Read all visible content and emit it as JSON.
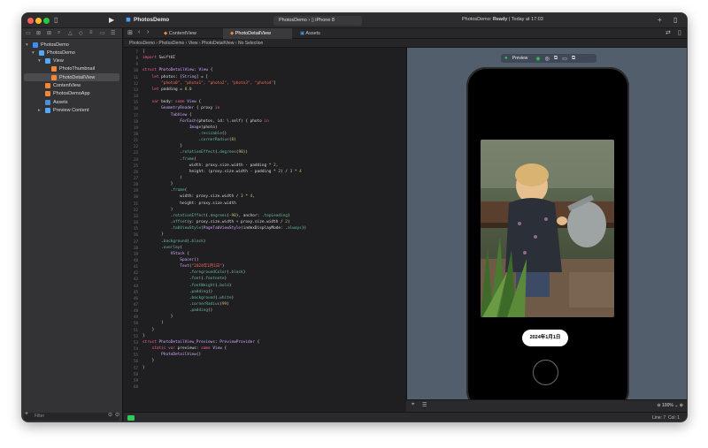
{
  "window": {
    "project": "PhotosDemo",
    "scheme": "PhotosDemo",
    "device": "iPhone 8",
    "status_prefix": "PhotosDemo: ",
    "status_state": "Ready",
    "status_time": " | Today at 17:03"
  },
  "sidebar": {
    "items": [
      {
        "label": "PhotosDemo",
        "indent": 0,
        "disclosure": "▾",
        "icon": "project-icon",
        "color": "#3b8ef3",
        "selected": false
      },
      {
        "label": "PhotosDemo",
        "indent": 1,
        "disclosure": "▾",
        "icon": "folder-icon",
        "color": "#56a8f5",
        "selected": false
      },
      {
        "label": "View",
        "indent": 2,
        "disclosure": "▾",
        "icon": "folder-icon",
        "color": "#56a8f5",
        "selected": false
      },
      {
        "label": "PhotoThumbnail",
        "indent": 3,
        "disclosure": "",
        "icon": "swift-file-icon",
        "color": "#f0873a",
        "selected": false
      },
      {
        "label": "PhotoDetailView",
        "indent": 3,
        "disclosure": "",
        "icon": "swift-file-icon",
        "color": "#f0873a",
        "selected": true
      },
      {
        "label": "ContentView",
        "indent": 2,
        "disclosure": "",
        "icon": "swift-file-icon",
        "color": "#f0873a",
        "selected": false
      },
      {
        "label": "PhotosDemoApp",
        "indent": 2,
        "disclosure": "",
        "icon": "swift-file-icon",
        "color": "#f0873a",
        "selected": false
      },
      {
        "label": "Assets",
        "indent": 2,
        "disclosure": "",
        "icon": "assets-icon",
        "color": "#4a90d9",
        "selected": false
      },
      {
        "label": "Preview Content",
        "indent": 2,
        "disclosure": "▸",
        "icon": "folder-icon",
        "color": "#56a8f5",
        "selected": false
      }
    ],
    "filter_placeholder": "Filter"
  },
  "tabs": [
    {
      "label": "ContentView",
      "active": false
    },
    {
      "label": "PhotoDetailView",
      "active": true
    },
    {
      "label": "Assets",
      "active": false
    }
  ],
  "jumpbar": {
    "crumbs": [
      "PhotosDemo",
      "PhotosDemo",
      "View",
      "PhotoDetailView",
      "No Selection"
    ]
  },
  "editor": {
    "line_numbers": [
      "7",
      "8",
      "9",
      "10",
      "11",
      "12",
      "13",
      "14",
      "15",
      "16",
      "17",
      "18",
      "19",
      "20",
      "21",
      "22",
      "23",
      "24",
      "25",
      "26",
      "27",
      "28",
      "29",
      "30",
      "31",
      "32",
      "33",
      "34",
      "35",
      "36",
      "37",
      "38",
      "39",
      "40",
      "41",
      "42",
      "43",
      "44",
      "45",
      "46",
      "47",
      "48",
      "49",
      "50",
      "51",
      "52",
      "53",
      "54",
      "55",
      "56",
      "57",
      "58",
      "59",
      "60"
    ],
    "lines": [
      [
        {
          "t": "|",
          "c": ""
        }
      ],
      [
        {
          "t": "import ",
          "c": "kw"
        },
        {
          "t": "SwiftUI",
          "c": ""
        }
      ],
      [
        {
          "t": "",
          "c": ""
        }
      ],
      [
        {
          "t": "struct ",
          "c": "kw"
        },
        {
          "t": "PhotoDetailView",
          "c": "ty"
        },
        {
          "t": ": ",
          "c": ""
        },
        {
          "t": "View",
          "c": "ty"
        },
        {
          "t": " {",
          "c": ""
        }
      ],
      [
        {
          "t": "    let ",
          "c": "kw"
        },
        {
          "t": "photos: [",
          "c": ""
        },
        {
          "t": "String",
          "c": "ty"
        },
        {
          "t": "] = [",
          "c": ""
        }
      ],
      [
        {
          "t": "        ",
          "c": ""
        },
        {
          "t": "\"photo0\", \"photo1\", \"photo2\", \"photo3\", \"photo4\"",
          "c": "str"
        },
        {
          "t": "]",
          "c": ""
        }
      ],
      [
        {
          "t": "    let ",
          "c": "kw"
        },
        {
          "t": "padding = ",
          "c": ""
        },
        {
          "t": "8.0",
          "c": "num"
        }
      ],
      [
        {
          "t": "",
          "c": ""
        }
      ],
      [
        {
          "t": "    var ",
          "c": "kw"
        },
        {
          "t": "body: ",
          "c": ""
        },
        {
          "t": "some ",
          "c": "kw"
        },
        {
          "t": "View",
          "c": "ty"
        },
        {
          "t": " {",
          "c": ""
        }
      ],
      [
        {
          "t": "        ",
          "c": ""
        },
        {
          "t": "GeometryReader",
          "c": "ty"
        },
        {
          "t": " { proxy ",
          "c": ""
        },
        {
          "t": "in",
          "c": "kw"
        }
      ],
      [
        {
          "t": "            ",
          "c": ""
        },
        {
          "t": "TabView",
          "c": "ty"
        },
        {
          "t": " {",
          "c": ""
        }
      ],
      [
        {
          "t": "                ",
          "c": ""
        },
        {
          "t": "ForEach",
          "c": "ty"
        },
        {
          "t": "(photos, id: \\.self) { photo ",
          "c": ""
        },
        {
          "t": "in",
          "c": "kw"
        }
      ],
      [
        {
          "t": "                    ",
          "c": ""
        },
        {
          "t": "Image",
          "c": "ty"
        },
        {
          "t": "(photo)",
          "c": ""
        }
      ],
      [
        {
          "t": "                        .",
          "c": ""
        },
        {
          "t": "resizable",
          "c": "fn"
        },
        {
          "t": "()",
          "c": ""
        }
      ],
      [
        {
          "t": "                        .",
          "c": ""
        },
        {
          "t": "cornerRadius",
          "c": "fn"
        },
        {
          "t": "(",
          "c": ""
        },
        {
          "t": "8",
          "c": "num"
        },
        {
          "t": ")",
          "c": ""
        }
      ],
      [
        {
          "t": "                }",
          "c": ""
        }
      ],
      [
        {
          "t": "                .",
          "c": ""
        },
        {
          "t": "rotationEffect",
          "c": "fn"
        },
        {
          "t": "(.",
          "c": ""
        },
        {
          "t": "degrees",
          "c": "fn"
        },
        {
          "t": "(",
          "c": ""
        },
        {
          "t": "90",
          "c": "num"
        },
        {
          "t": "))",
          "c": ""
        }
      ],
      [
        {
          "t": "                .",
          "c": ""
        },
        {
          "t": "frame",
          "c": "fn"
        },
        {
          "t": "(",
          "c": ""
        }
      ],
      [
        {
          "t": "                    width: proxy.size.width - padding * ",
          "c": ""
        },
        {
          "t": "2",
          "c": "num"
        },
        {
          "t": ",",
          "c": ""
        }
      ],
      [
        {
          "t": "                    height: (proxy.size.width - padding * ",
          "c": ""
        },
        {
          "t": "2",
          "c": "num"
        },
        {
          "t": ") / ",
          "c": ""
        },
        {
          "t": "3",
          "c": "num"
        },
        {
          "t": " * ",
          "c": ""
        },
        {
          "t": "4",
          "c": "num"
        }
      ],
      [
        {
          "t": "                )",
          "c": ""
        }
      ],
      [
        {
          "t": "            }",
          "c": ""
        }
      ],
      [
        {
          "t": "            .",
          "c": ""
        },
        {
          "t": "frame",
          "c": "fn"
        },
        {
          "t": "(",
          "c": ""
        }
      ],
      [
        {
          "t": "                width: proxy.size.width / ",
          "c": ""
        },
        {
          "t": "3",
          "c": "num"
        },
        {
          "t": " * ",
          "c": ""
        },
        {
          "t": "4",
          "c": "num"
        },
        {
          "t": ",",
          "c": ""
        }
      ],
      [
        {
          "t": "                height: proxy.size.width",
          "c": ""
        }
      ],
      [
        {
          "t": "            )",
          "c": ""
        }
      ],
      [
        {
          "t": "            .",
          "c": ""
        },
        {
          "t": "rotationEffect",
          "c": "fn"
        },
        {
          "t": "(.",
          "c": ""
        },
        {
          "t": "degrees",
          "c": "fn"
        },
        {
          "t": "(-",
          "c": ""
        },
        {
          "t": "90",
          "c": "num"
        },
        {
          "t": "), anchor: .",
          "c": ""
        },
        {
          "t": "topLeading",
          "c": "fn"
        },
        {
          "t": ")",
          "c": ""
        }
      ],
      [
        {
          "t": "            .",
          "c": ""
        },
        {
          "t": "offset",
          "c": "fn"
        },
        {
          "t": "(y: proxy.size.width + proxy.size.width / ",
          "c": ""
        },
        {
          "t": "2",
          "c": "num"
        },
        {
          "t": ")",
          "c": ""
        }
      ],
      [
        {
          "t": "            .",
          "c": ""
        },
        {
          "t": "tabViewStyle",
          "c": "fn"
        },
        {
          "t": "(",
          "c": ""
        },
        {
          "t": "PageTabViewStyle",
          "c": "ty"
        },
        {
          "t": "(indexDisplayMode: .",
          "c": ""
        },
        {
          "t": "always",
          "c": "fn"
        },
        {
          "t": "))",
          "c": ""
        }
      ],
      [
        {
          "t": "        }",
          "c": ""
        }
      ],
      [
        {
          "t": "        .",
          "c": ""
        },
        {
          "t": "background",
          "c": "fn"
        },
        {
          "t": "(.",
          "c": ""
        },
        {
          "t": "black",
          "c": "fn"
        },
        {
          "t": ")",
          "c": ""
        }
      ],
      [
        {
          "t": "        .",
          "c": ""
        },
        {
          "t": "overlay",
          "c": "fn"
        },
        {
          "t": "(",
          "c": ""
        }
      ],
      [
        {
          "t": "            ",
          "c": ""
        },
        {
          "t": "VStack",
          "c": "ty"
        },
        {
          "t": " {",
          "c": ""
        }
      ],
      [
        {
          "t": "                ",
          "c": ""
        },
        {
          "t": "Spacer",
          "c": "ty"
        },
        {
          "t": "()",
          "c": ""
        }
      ],
      [
        {
          "t": "                ",
          "c": ""
        },
        {
          "t": "Text",
          "c": "ty"
        },
        {
          "t": "(",
          "c": ""
        },
        {
          "t": "\"2024年1月1日\"",
          "c": "str"
        },
        {
          "t": ")",
          "c": ""
        }
      ],
      [
        {
          "t": "                    .",
          "c": ""
        },
        {
          "t": "foregroundColor",
          "c": "fn"
        },
        {
          "t": "(.",
          "c": ""
        },
        {
          "t": "black",
          "c": "fn"
        },
        {
          "t": ")",
          "c": ""
        }
      ],
      [
        {
          "t": "                    .",
          "c": ""
        },
        {
          "t": "font",
          "c": "fn"
        },
        {
          "t": "(.",
          "c": ""
        },
        {
          "t": "footnote",
          "c": "fn"
        },
        {
          "t": ")",
          "c": ""
        }
      ],
      [
        {
          "t": "                    .",
          "c": ""
        },
        {
          "t": "fontWeight",
          "c": "fn"
        },
        {
          "t": "(.",
          "c": ""
        },
        {
          "t": "bold",
          "c": "fn"
        },
        {
          "t": ")",
          "c": ""
        }
      ],
      [
        {
          "t": "                    .",
          "c": ""
        },
        {
          "t": "padding",
          "c": "fn"
        },
        {
          "t": "()",
          "c": ""
        }
      ],
      [
        {
          "t": "                    .",
          "c": ""
        },
        {
          "t": "background",
          "c": "fn"
        },
        {
          "t": "(.",
          "c": ""
        },
        {
          "t": "white",
          "c": "fn"
        },
        {
          "t": ")",
          "c": ""
        }
      ],
      [
        {
          "t": "                    .",
          "c": ""
        },
        {
          "t": "cornerRadius",
          "c": "fn"
        },
        {
          "t": "(",
          "c": ""
        },
        {
          "t": "99",
          "c": "num"
        },
        {
          "t": ")",
          "c": ""
        }
      ],
      [
        {
          "t": "                    .",
          "c": ""
        },
        {
          "t": "padding",
          "c": "fn"
        },
        {
          "t": "()",
          "c": ""
        }
      ],
      [
        {
          "t": "            }",
          "c": ""
        }
      ],
      [
        {
          "t": "        )",
          "c": ""
        }
      ],
      [
        {
          "t": "    }",
          "c": ""
        }
      ],
      [
        {
          "t": "}",
          "c": ""
        }
      ],
      [
        {
          "t": "struct ",
          "c": "kw"
        },
        {
          "t": "PhotoDetailView_Previews",
          "c": "ty"
        },
        {
          "t": ": ",
          "c": ""
        },
        {
          "t": "PreviewProvider",
          "c": "ty"
        },
        {
          "t": " {",
          "c": ""
        }
      ],
      [
        {
          "t": "    static var ",
          "c": "kw"
        },
        {
          "t": "previews: ",
          "c": ""
        },
        {
          "t": "some ",
          "c": "kw"
        },
        {
          "t": "View",
          "c": "ty"
        },
        {
          "t": " {",
          "c": ""
        }
      ],
      [
        {
          "t": "        ",
          "c": ""
        },
        {
          "t": "PhotoDetailView",
          "c": "ty"
        },
        {
          "t": "()",
          "c": ""
        }
      ],
      [
        {
          "t": "    }",
          "c": ""
        }
      ],
      [
        {
          "t": "}",
          "c": ""
        }
      ]
    ]
  },
  "preview": {
    "label": "Preview",
    "date_text": "2024年1月1日",
    "zoom": "100%"
  },
  "statusbar": {
    "line": "Line: 7",
    "col": "Col: 1"
  },
  "colors": {
    "accent": "#3b8ef3",
    "swift_file": "#f0873a",
    "preview_live": "#34c759"
  }
}
